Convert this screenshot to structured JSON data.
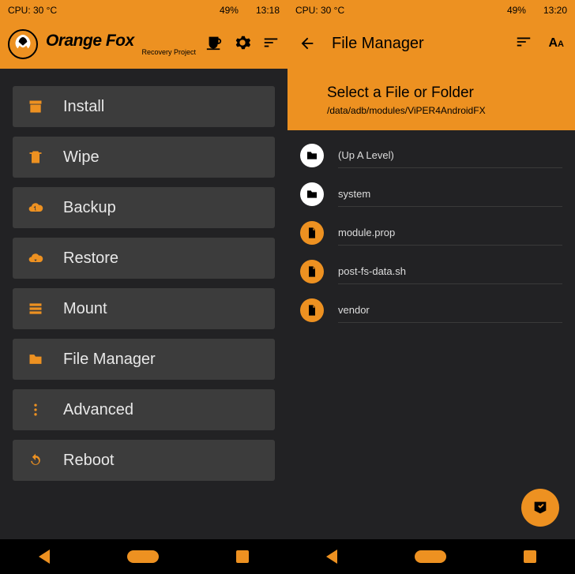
{
  "colors": {
    "accent": "#ed9121",
    "dark": "#222224",
    "tile": "#3c3c3c"
  },
  "left": {
    "status": {
      "cpu": "CPU: 30 °C",
      "battery": "49%",
      "time": "13:18"
    },
    "brand": {
      "main": "Orange Fox",
      "sub": "Recovery Project"
    },
    "menu": [
      {
        "icon": "archive",
        "label": "Install"
      },
      {
        "icon": "trash",
        "label": "Wipe"
      },
      {
        "icon": "cloud-up",
        "label": "Backup"
      },
      {
        "icon": "cloud-down",
        "label": "Restore"
      },
      {
        "icon": "storage",
        "label": "Mount"
      },
      {
        "icon": "folder",
        "label": "File Manager"
      },
      {
        "icon": "more-vert",
        "label": "Advanced"
      },
      {
        "icon": "refresh",
        "label": "Reboot"
      }
    ]
  },
  "right": {
    "status": {
      "cpu": "CPU: 30 °C",
      "battery": "49%",
      "time": "13:20"
    },
    "title": "File Manager",
    "hint": "Select a File or Folder",
    "path": "/data/adb/modules/ViPER4AndroidFX",
    "files": [
      {
        "type": "up",
        "name": "(Up A Level)"
      },
      {
        "type": "folder",
        "name": "system"
      },
      {
        "type": "file",
        "name": "module.prop"
      },
      {
        "type": "file",
        "name": "post-fs-data.sh"
      },
      {
        "type": "file",
        "name": "vendor"
      }
    ]
  }
}
